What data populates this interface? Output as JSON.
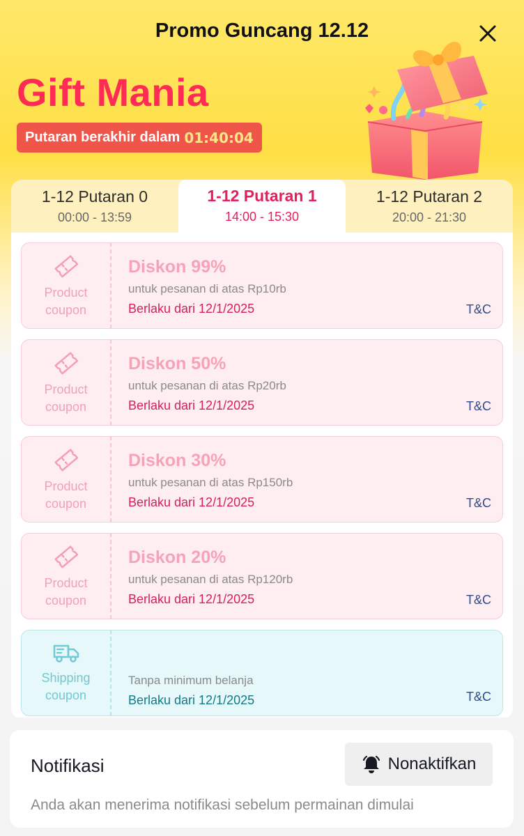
{
  "header": {
    "title": "Promo Guncang 12.12",
    "brand": "Gift Mania",
    "countdown_label": "Putaran berakhir dalam",
    "countdown_time": "01:40:04"
  },
  "tabs": [
    {
      "name": "1-12 Putaran 0",
      "time": "00:00 - 13:59"
    },
    {
      "name": "1-12 Putaran 1",
      "time": "14:00 - 15:30"
    },
    {
      "name": "1-12 Putaran 2",
      "time": "20:00 - 21:30"
    }
  ],
  "coupons": [
    {
      "type": "Product coupon",
      "type_l1": "Product",
      "type_l2": "coupon",
      "title": "Diskon 99%",
      "condition": "untuk pesanan di atas Rp10rb",
      "valid": "Berlaku dari 12/1/2025",
      "tnc": "T&C"
    },
    {
      "type": "Product coupon",
      "type_l1": "Product",
      "type_l2": "coupon",
      "title": "Diskon 50%",
      "condition": "untuk pesanan di atas Rp20rb",
      "valid": "Berlaku dari 12/1/2025",
      "tnc": "T&C"
    },
    {
      "type": "Product coupon",
      "type_l1": "Product",
      "type_l2": "coupon",
      "title": "Diskon 30%",
      "condition": "untuk pesanan di atas Rp150rb",
      "valid": "Berlaku dari 12/1/2025",
      "tnc": "T&C"
    },
    {
      "type": "Product coupon",
      "type_l1": "Product",
      "type_l2": "coupon",
      "title": "Diskon 20%",
      "condition": "untuk pesanan di atas Rp120rb",
      "valid": "Berlaku dari 12/1/2025",
      "tnc": "T&C"
    },
    {
      "type": "Shipping coupon",
      "type_l1": "Shipping",
      "type_l2": "coupon",
      "title": "",
      "condition": "Tanpa minimum belanja",
      "valid": "Berlaku dari 12/1/2025",
      "tnc": "T&C"
    }
  ],
  "notification": {
    "title": "Notifikasi",
    "button": "Nonaktifkan",
    "description": "Anda akan menerima notifikasi sebelum permainan dimulai"
  },
  "colors": {
    "brand": "#FE2C55",
    "active_tab": "#E61E5B",
    "countdown_bg": "#F05549"
  },
  "icons": [
    "close-icon",
    "gift-box-illustration",
    "ticket-icon",
    "truck-icon",
    "bell-icon"
  ]
}
